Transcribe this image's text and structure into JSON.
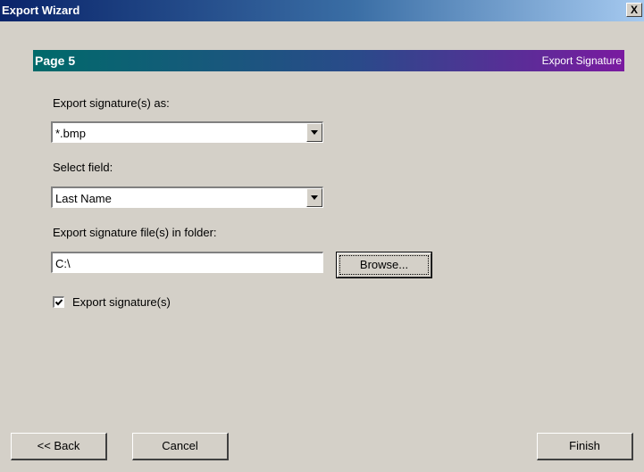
{
  "window": {
    "title": "Export Wizard",
    "close_glyph": "X"
  },
  "banner": {
    "page": "Page 5",
    "name": "Export Signature",
    "colors": [
      "#006a6a",
      "#7a1aa0"
    ]
  },
  "form": {
    "format_label": "Export signature(s) as:",
    "format_value": "*.bmp",
    "field_label": "Select field:",
    "field_value": "Last Name",
    "folder_label": "Export signature file(s) in folder:",
    "folder_value": "C:\\",
    "browse_label": "Browse...",
    "export_checkbox_label": "Export signature(s)",
    "export_checked": true
  },
  "footer": {
    "back_label": "<< Back",
    "cancel_label": "Cancel",
    "finish_label": "Finish"
  }
}
